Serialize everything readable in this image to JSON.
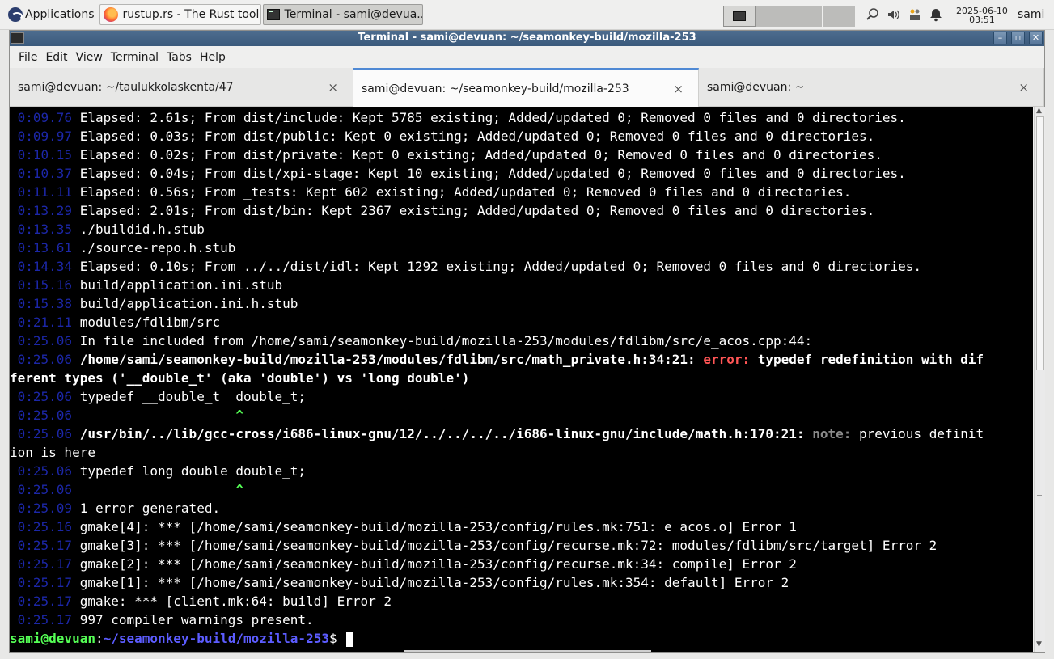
{
  "panel": {
    "applications_label": "Applications",
    "tasks": [
      {
        "label": "rustup.rs - The Rust tool...",
        "icon": "firefox-icon",
        "active": false
      },
      {
        "label": "Terminal - sami@devua...",
        "icon": "terminal-icon",
        "active": true
      }
    ],
    "clock_date": "2025-06-10",
    "clock_time": "03:51",
    "user": "sami"
  },
  "window": {
    "title": "Terminal - sami@devuan: ~/seamonkey-build/mozilla-253",
    "menu": [
      "File",
      "Edit",
      "View",
      "Terminal",
      "Tabs",
      "Help"
    ],
    "tabs": [
      {
        "label": "sami@devuan: ~/taulukkolaskenta/47",
        "active": false
      },
      {
        "label": "sami@devuan: ~/seamonkey-build/mozilla-253",
        "active": true
      },
      {
        "label": "sami@devuan: ~",
        "active": false
      }
    ],
    "close_glyph": "×"
  },
  "terminal": {
    "lines": [
      {
        "ts": " 0:09.76",
        "text": " Elapsed: 2.61s; From dist/include: Kept 5785 existing; Added/updated 0; Removed 0 files and 0 directories."
      },
      {
        "ts": " 0:09.97",
        "text": " Elapsed: 0.03s; From dist/public: Kept 0 existing; Added/updated 0; Removed 0 files and 0 directories."
      },
      {
        "ts": " 0:10.15",
        "text": " Elapsed: 0.02s; From dist/private: Kept 0 existing; Added/updated 0; Removed 0 files and 0 directories."
      },
      {
        "ts": " 0:10.37",
        "text": " Elapsed: 0.04s; From dist/xpi-stage: Kept 10 existing; Added/updated 0; Removed 0 files and 0 directories."
      },
      {
        "ts": " 0:11.11",
        "text": " Elapsed: 0.56s; From _tests: Kept 602 existing; Added/updated 0; Removed 0 files and 0 directories."
      },
      {
        "ts": " 0:13.29",
        "text": " Elapsed: 2.01s; From dist/bin: Kept 2367 existing; Added/updated 0; Removed 0 files and 0 directories."
      },
      {
        "ts": " 0:13.35",
        "text": " ./buildid.h.stub"
      },
      {
        "ts": " 0:13.61",
        "text": " ./source-repo.h.stub"
      },
      {
        "ts": " 0:14.34",
        "text": " Elapsed: 0.10s; From ../../dist/idl: Kept 1292 existing; Added/updated 0; Removed 0 files and 0 directories."
      },
      {
        "ts": " 0:15.16",
        "text": " build/application.ini.stub"
      },
      {
        "ts": " 0:15.38",
        "text": " build/application.ini.h.stub"
      },
      {
        "ts": " 0:21.11",
        "text": " modules/fdlibm/src"
      },
      {
        "ts": " 0:25.06",
        "text": " In file included from /home/sami/seamonkey-build/mozilla-253/modules/fdlibm/src/e_acos.cpp:44:"
      }
    ],
    "error_line": {
      "ts": " 0:25.06",
      "path": " /home/sami/seamonkey-build/mozilla-253/modules/fdlibm/src/math_private.h:34:21: ",
      "tag": "error:",
      "msg": " typedef redefinition with dif",
      "wrap": "ferent types ('__double_t' (aka 'double') vs 'long double')"
    },
    "line_typedef1": {
      "ts": " 0:25.06",
      "text": " typedef __double_t  double_t;"
    },
    "caret1": {
      "ts": " 0:25.06",
      "pad": "                     ",
      "caret": "^"
    },
    "note_line": {
      "ts": " 0:25.06",
      "path": " /usr/bin/../lib/gcc-cross/i686-linux-gnu/12/../../../../i686-linux-gnu/include/math.h:170:21: ",
      "tag": "note:",
      "msg": " previous definit",
      "wrap": "ion is here"
    },
    "line_typedef2": {
      "ts": " 0:25.06",
      "text": " typedef long double double_t;"
    },
    "caret2": {
      "ts": " 0:25.06",
      "pad": "                     ",
      "caret": "^"
    },
    "tail_lines": [
      {
        "ts": " 0:25.09",
        "text": " 1 error generated."
      },
      {
        "ts": " 0:25.16",
        "text": " gmake[4]: *** [/home/sami/seamonkey-build/mozilla-253/config/rules.mk:751: e_acos.o] Error 1"
      },
      {
        "ts": " 0:25.17",
        "text": " gmake[3]: *** [/home/sami/seamonkey-build/mozilla-253/config/recurse.mk:72: modules/fdlibm/src/target] Error 2"
      },
      {
        "ts": " 0:25.17",
        "text": " gmake[2]: *** [/home/sami/seamonkey-build/mozilla-253/config/recurse.mk:34: compile] Error 2"
      },
      {
        "ts": " 0:25.17",
        "text": " gmake[1]: *** [/home/sami/seamonkey-build/mozilla-253/config/rules.mk:354: default] Error 2"
      },
      {
        "ts": " 0:25.17",
        "text": " gmake: *** [client.mk:64: build] Error 2"
      },
      {
        "ts": " 0:25.17",
        "text": " 997 compiler warnings present."
      }
    ],
    "prompt": {
      "user_host": "sami@devuan",
      "sep": ":",
      "path": "~/seamonkey-build/mozilla-253",
      "symbol": "$ "
    }
  }
}
